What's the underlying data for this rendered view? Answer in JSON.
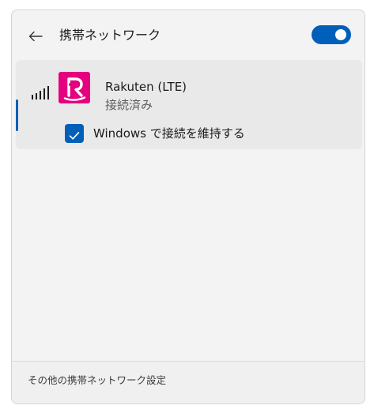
{
  "header": {
    "title": "携帯ネットワーク",
    "back_icon": "back-arrow-icon",
    "cellular_enabled": true
  },
  "network": {
    "name": "Rakuten (LTE)",
    "status": "接続済み",
    "logo_letter": "R",
    "logo_color": "#e4007f",
    "signal_icon": "signal-strength-icon"
  },
  "option": {
    "label": "Windows で接続を維持する",
    "checked": true
  },
  "footer": {
    "link_label": "その他の携帯ネットワーク設定"
  },
  "colors": {
    "accent": "#005fb8"
  }
}
